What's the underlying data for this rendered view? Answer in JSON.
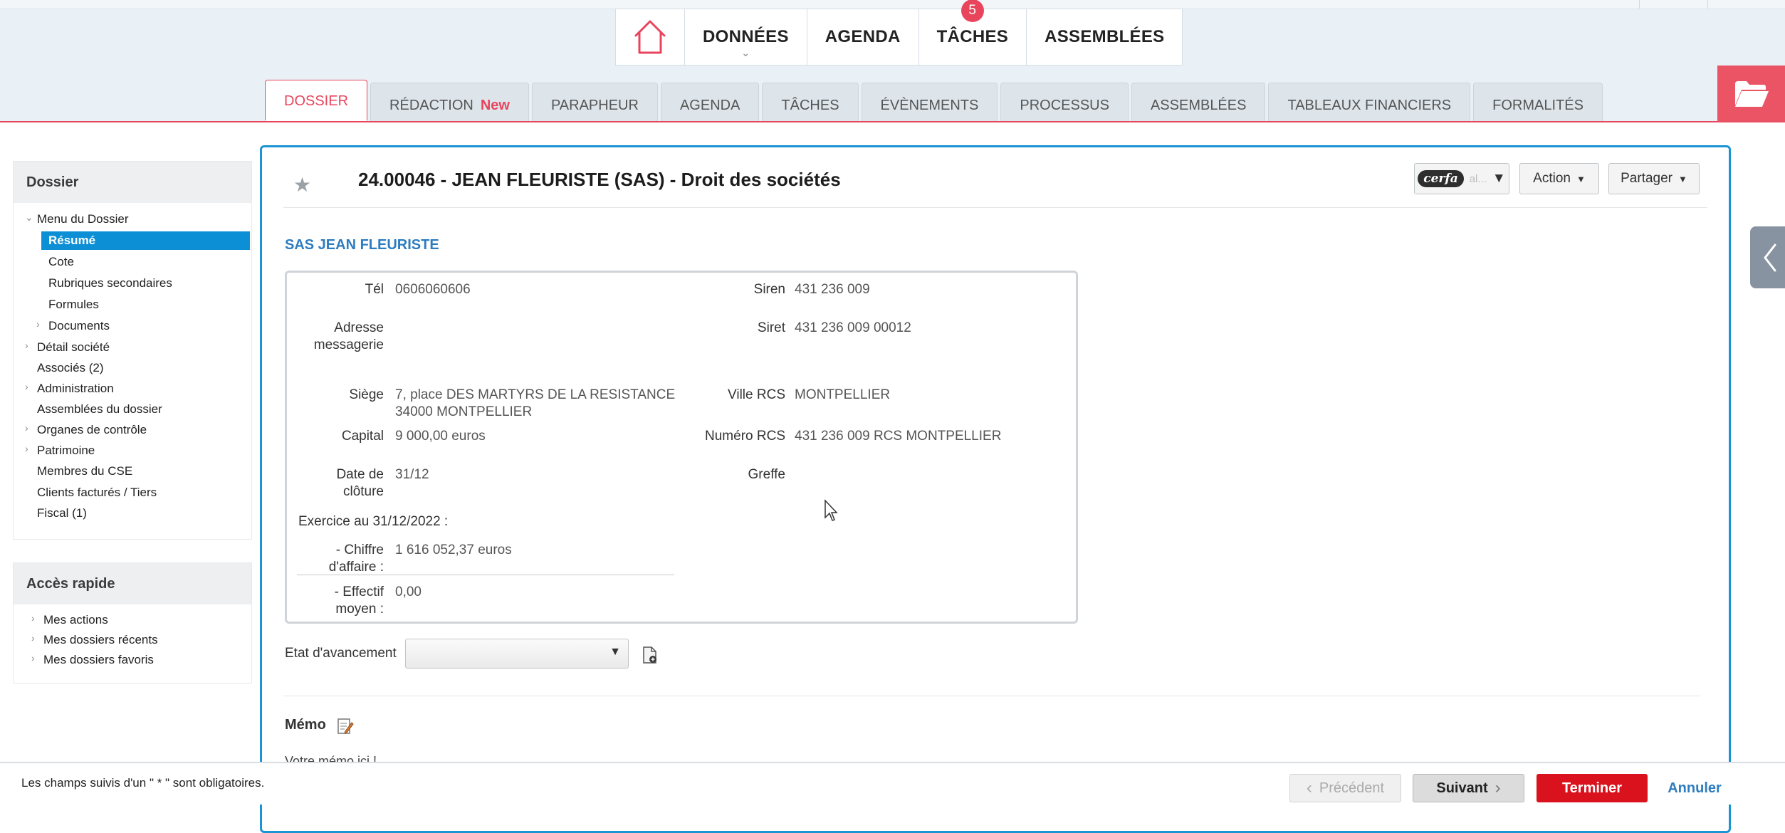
{
  "colors": {
    "accent": "#e8455c",
    "primary_blue": "#1a94d3",
    "selected_blue": "#0d8fd6",
    "danger_red": "#d9121e"
  },
  "mainnav": {
    "home_icon": "home-icon",
    "items": [
      {
        "label": "DONNÉES"
      },
      {
        "label": "AGENDA"
      },
      {
        "label": "TÂCHES",
        "badge": "5"
      },
      {
        "label": "ASSEMBLÉES"
      }
    ]
  },
  "tabs": [
    {
      "label": "DOSSIER",
      "active": true
    },
    {
      "label": "RÉDACTION",
      "tag": "New"
    },
    {
      "label": "PARAPHEUR"
    },
    {
      "label": "AGENDA"
    },
    {
      "label": "TÂCHES"
    },
    {
      "label": "ÉVÈNEMENTS"
    },
    {
      "label": "PROCESSUS"
    },
    {
      "label": "ASSEMBLÉES"
    },
    {
      "label": "TABLEAUX FINANCIERS"
    },
    {
      "label": "FORMALITÉS"
    }
  ],
  "sidebar": {
    "dossier": {
      "title": "Dossier",
      "items": [
        {
          "label": "Menu du Dossier",
          "state": "expanded"
        },
        {
          "label": "Résumé",
          "selected": true
        },
        {
          "label": "Cote"
        },
        {
          "label": "Rubriques secondaires"
        },
        {
          "label": "Formules"
        },
        {
          "label": "Documents",
          "state": "collapsed"
        },
        {
          "label": "Détail société",
          "state": "collapsed"
        },
        {
          "label": "Associés (2)"
        },
        {
          "label": "Administration",
          "state": "collapsed"
        },
        {
          "label": "Assemblées du dossier"
        },
        {
          "label": "Organes de contrôle",
          "state": "collapsed"
        },
        {
          "label": "Patrimoine",
          "state": "collapsed"
        },
        {
          "label": "Membres du CSE"
        },
        {
          "label": "Clients facturés / Tiers"
        },
        {
          "label": "Fiscal (1)"
        }
      ]
    },
    "acces": {
      "title": "Accès rapide",
      "items": [
        {
          "label": "Mes actions"
        },
        {
          "label": "Mes dossiers récents"
        },
        {
          "label": "Mes dossiers favoris"
        }
      ]
    }
  },
  "main": {
    "title": "24.00046 - JEAN FLEURISTE (SAS) - Droit des sociétés",
    "buttons": {
      "cerfa": "cerfa",
      "cerfa_rest": "al...",
      "action": "Action",
      "share": "Partager"
    },
    "company": "SAS JEAN FLEURISTE",
    "info": {
      "tel_label": "Tél",
      "tel": "0606060606",
      "adresse_label": "Adresse messagerie",
      "adresse": "",
      "siege_label": "Siège",
      "siege_line1": "7, place DES MARTYRS DE LA RESISTANCE",
      "siege_line2": "34000 MONTPELLIER",
      "capital_label": "Capital",
      "capital": "9 000,00 euros",
      "cloture_label": "Date de clôture",
      "cloture": "31/12",
      "exercice": "Exercice au 31/12/2022 :",
      "ca_label": "- Chiffre d'affaire :",
      "ca": "1 616 052,37 euros",
      "effectif_label": "- Effectif moyen :",
      "effectif": "0,00",
      "siren_label": "Siren",
      "siren": "431 236 009",
      "siret_label": "Siret",
      "siret": "431 236 009 00012",
      "ville_label": "Ville RCS",
      "ville": "MONTPELLIER",
      "numrcs_label": "Numéro RCS",
      "numrcs": "431 236 009 RCS MONTPELLIER",
      "greffe_label": "Greffe",
      "greffe": ""
    },
    "etat_label": "Etat d'avancement",
    "etat_value": "",
    "memo_title": "Mémo",
    "memo_placeholder": "Votre mémo ici !"
  },
  "footer": {
    "note": "Les champs suivis d'un \" * \" sont obligatoires.",
    "prev": "Précédent",
    "next": "Suivant",
    "finish": "Terminer",
    "cancel": "Annuler"
  }
}
